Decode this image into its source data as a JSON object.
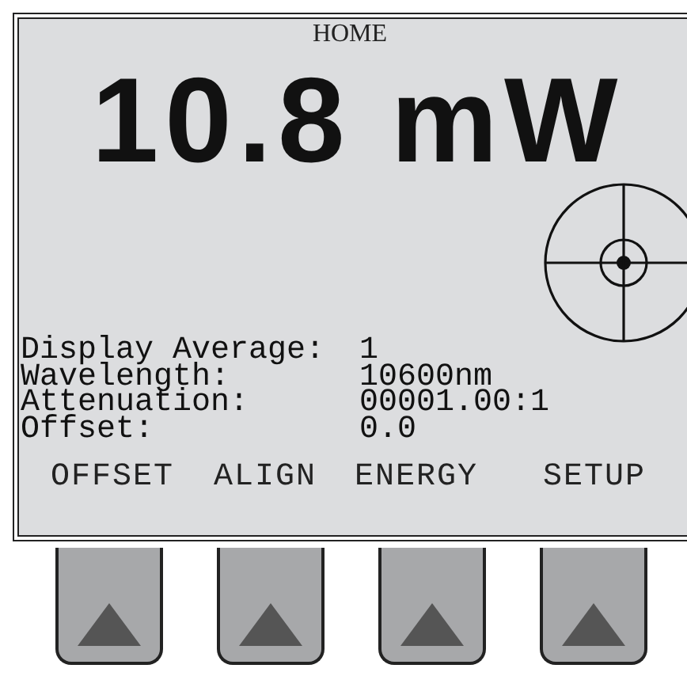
{
  "screen": {
    "title": "HOME",
    "reading": "10.8 mW",
    "settings": [
      {
        "label": "Display Average:",
        "value": "1"
      },
      {
        "label": "Wavelength:",
        "value": "10600nm"
      },
      {
        "label": "Attenuation:",
        "value": "00001.00:1"
      },
      {
        "label": "Offset:",
        "value": "0.0"
      }
    ],
    "softkeys": [
      {
        "label": "OFFSET"
      },
      {
        "label": "ALIGN"
      },
      {
        "label": "ENERGY"
      },
      {
        "label": "SETUP"
      }
    ]
  }
}
